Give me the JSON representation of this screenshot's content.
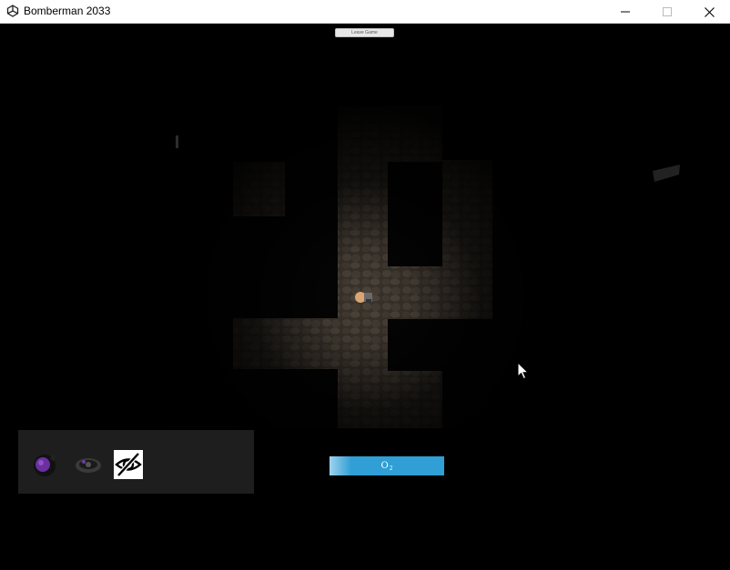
{
  "window": {
    "title": "Bomberman 2033",
    "minimize_label": "minimize",
    "maximize_label": "maximize",
    "close_label": "close"
  },
  "game": {
    "leave_button_label": "Leave Game",
    "o2": {
      "label": "O",
      "subscript": "2",
      "level": 1.0,
      "color": "#2f9fd6"
    },
    "inventory": {
      "items": [
        {
          "icon": "purple-bomb-icon"
        },
        {
          "icon": "black-mine-icon"
        },
        {
          "icon": "eye-slash-icon"
        }
      ]
    },
    "colors": {
      "background": "#000000",
      "inventory_panel": "#1e1e1e",
      "floor": "#4a4036"
    }
  }
}
